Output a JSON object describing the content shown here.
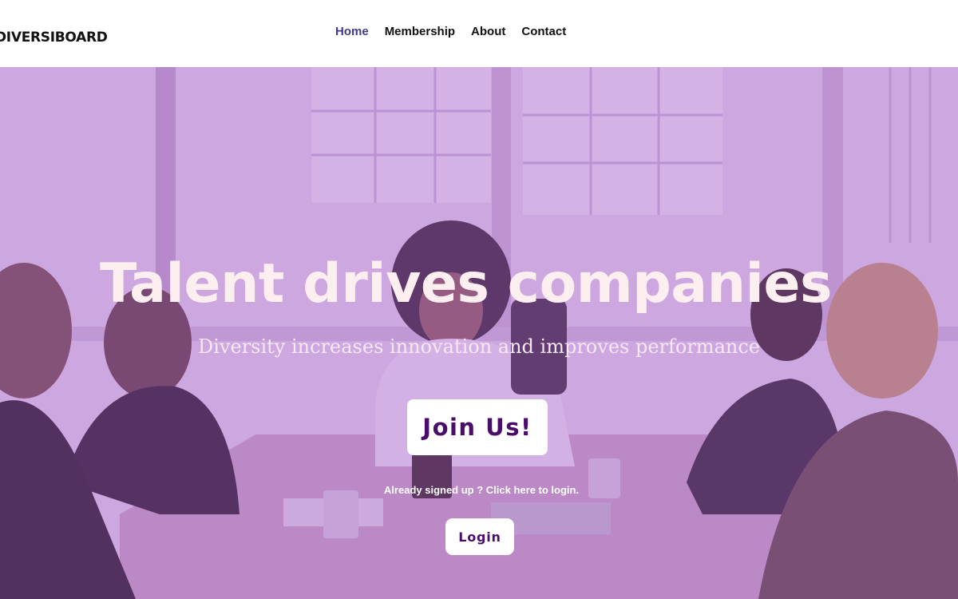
{
  "header": {
    "logo": "DIVERSIBOARD",
    "nav": [
      {
        "label": "Home",
        "active": true
      },
      {
        "label": "Membership",
        "active": false
      },
      {
        "label": "About",
        "active": false
      },
      {
        "label": "Contact",
        "active": false
      }
    ]
  },
  "hero": {
    "title": "Talent drives companies",
    "subtitle": "Diversity increases innovation and improves performance",
    "join_label": "Join Us!",
    "already_text": "Already signed up ? Click here to login.",
    "login_label": "Login"
  },
  "colors": {
    "accent": "#4b0d6b",
    "nav_active": "#3f3a8c",
    "overlay": "#a85ccd"
  }
}
